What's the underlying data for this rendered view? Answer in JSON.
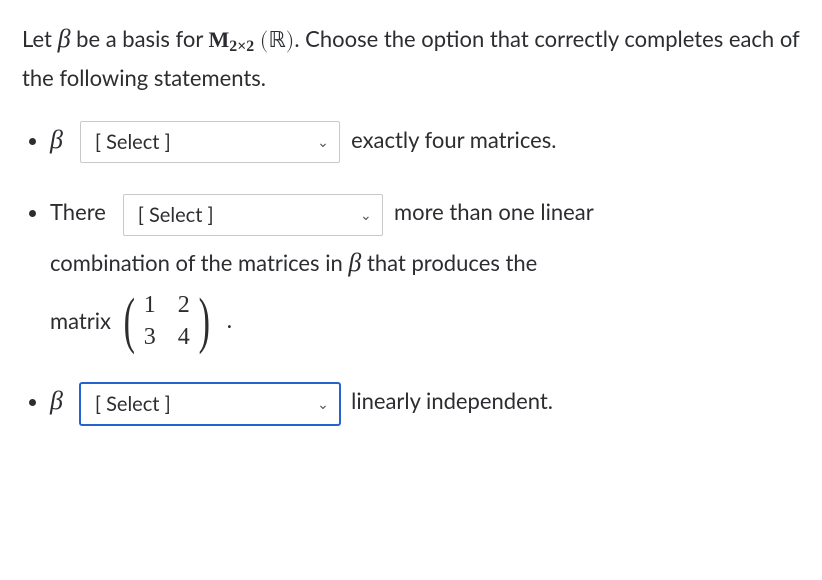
{
  "intro": {
    "part1": "Let ",
    "beta": "β",
    "part2": " be a basis for ",
    "Mlabel": "M",
    "subscript": "2×2",
    "paren_open": "(",
    "real_sym": "ℝ",
    "paren_close": ")",
    "part3": ".  Choose the option that correctly completes each of the following statements."
  },
  "select_placeholder": "[ Select ]",
  "bullet1": {
    "beta": "β",
    "after": "exactly four matrices."
  },
  "bullet2": {
    "lead": "There",
    "after1": "more than one linear",
    "line2_a": "combination of the matrices in ",
    "line2_beta": "β",
    "line2_b": " that produces the",
    "line3_prefix": "matrix",
    "matrix": {
      "a": "1",
      "b": "2",
      "c": "3",
      "d": "4"
    },
    "period": "."
  },
  "bullet3": {
    "beta": "β",
    "after": "linearly independent."
  }
}
